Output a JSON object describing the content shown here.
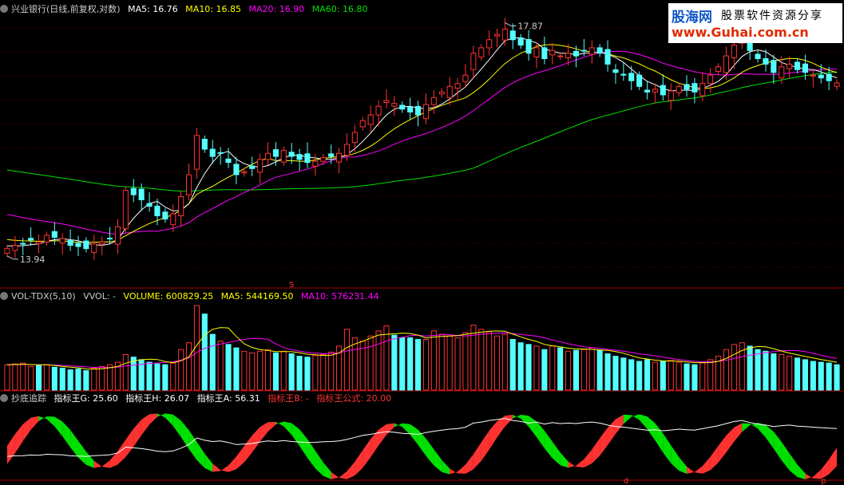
{
  "main_panel": {
    "title": "兴业银行(日线,前复权,对数)",
    "ma5": "MA5: 16.76",
    "ma10": "MA10: 16.85",
    "ma20": "MA20: 16.90",
    "ma60": "MA60: 16.80",
    "high_label": "17.87",
    "low_label": "13.94",
    "signal_label": "S"
  },
  "volume_panel": {
    "title": "VOL-TDX(5,10)",
    "vvol": "VVOL: -",
    "volume": "VOLUME: 600829.25",
    "ma5": "MA5: 544169.50",
    "ma10": "MA10: 576231.44"
  },
  "indicator_panel": {
    "title": "抄底追踪",
    "g": "指标王G: 25.60",
    "h": "指标王H: 26.07",
    "a": "指标王A: 56.31",
    "b": "指标王B: -",
    "formula": "指标王公式: 20.00",
    "markers": [
      "d",
      "p"
    ]
  },
  "watermark": {
    "name": "股海网",
    "slogan": "股票软件资源分享",
    "url": "www.Guhai.com.cn"
  },
  "colors": {
    "up": "#ff3232",
    "down": "#54ffff",
    "ma5": "#ffffff",
    "ma10": "#ffff00",
    "ma20": "#ff00ff",
    "ma60": "#00e000",
    "g": "#ff3232",
    "h": "#00e000",
    "a": "#ffffff"
  },
  "chart_data": [
    {
      "type": "candlestick",
      "title": "兴业银行(日线,前复权,对数)",
      "y_scale": "log",
      "ylim": [
        13.6,
        18.0
      ],
      "highest": 17.87,
      "lowest": 13.94,
      "series": [
        {
          "name": "MA5",
          "last": 16.76
        },
        {
          "name": "MA10",
          "last": 16.85
        },
        {
          "name": "MA20",
          "last": 16.9
        },
        {
          "name": "MA60",
          "last": 16.8
        }
      ],
      "close": [
        14.05,
        14.1,
        14.12,
        14.18,
        14.15,
        14.25,
        14.22,
        14.2,
        14.1,
        14.08,
        14.05,
        14.12,
        14.15,
        14.2,
        14.38,
        14.95,
        14.88,
        14.8,
        14.7,
        14.55,
        14.5,
        14.58,
        14.85,
        15.2,
        15.85,
        15.62,
        15.5,
        15.55,
        15.4,
        15.2,
        15.25,
        15.3,
        15.45,
        15.55,
        15.5,
        15.6,
        15.5,
        15.45,
        15.4,
        15.42,
        15.48,
        15.5,
        15.55,
        15.7,
        15.9,
        16.1,
        16.2,
        16.35,
        16.45,
        16.4,
        16.3,
        16.25,
        16.2,
        16.38,
        16.5,
        16.6,
        16.7,
        16.75,
        16.9,
        17.3,
        17.4,
        17.55,
        17.65,
        17.75,
        17.55,
        17.45,
        17.3,
        17.4,
        17.2,
        17.35,
        17.25,
        17.3,
        17.25,
        17.35,
        17.4,
        17.3,
        17.1,
        16.95,
        16.9,
        16.8,
        16.7,
        16.6,
        16.65,
        16.55,
        16.62,
        16.7,
        16.65,
        16.6,
        16.75,
        16.9,
        17.05,
        17.25,
        17.45,
        17.55,
        17.35,
        17.2,
        17.1,
        16.95,
        17.05,
        17.1,
        17.0,
        16.95,
        16.9,
        16.85,
        16.8,
        16.76
      ]
    },
    {
      "type": "bar",
      "title": "VOL-TDX(5,10)",
      "series": [
        {
          "name": "VOLUME",
          "last": 600829.25
        },
        {
          "name": "MA5",
          "last": 544169.5
        },
        {
          "name": "MA10",
          "last": 576231.44
        }
      ],
      "values": [
        300,
        310,
        320,
        280,
        290,
        300,
        270,
        260,
        240,
        250,
        230,
        260,
        280,
        300,
        330,
        420,
        390,
        360,
        330,
        310,
        300,
        320,
        480,
        560,
        1000,
        900,
        660,
        580,
        540,
        500,
        460,
        440,
        460,
        480,
        440,
        460,
        430,
        400,
        390,
        410,
        420,
        450,
        520,
        720,
        620,
        580,
        640,
        700,
        760,
        650,
        620,
        620,
        600,
        600,
        700,
        660,
        640,
        620,
        680,
        770,
        720,
        690,
        640,
        660,
        600,
        560,
        540,
        520,
        480,
        520,
        500,
        460,
        470,
        480,
        500,
        470,
        430,
        400,
        380,
        360,
        340,
        360,
        330,
        340,
        350,
        330,
        310,
        300,
        330,
        360,
        400,
        480,
        540,
        560,
        520,
        480,
        460,
        430,
        420,
        400,
        380,
        360,
        340,
        330,
        320,
        300
      ]
    },
    {
      "type": "line",
      "title": "抄底追踪",
      "series": [
        {
          "name": "指标王G",
          "last": 25.6
        },
        {
          "name": "指标王H",
          "last": 26.07
        },
        {
          "name": "指标王A",
          "last": 56.31
        },
        {
          "name": "指标王B",
          "last": "-"
        },
        {
          "name": "指标王公式",
          "last": 20.0
        }
      ]
    }
  ]
}
